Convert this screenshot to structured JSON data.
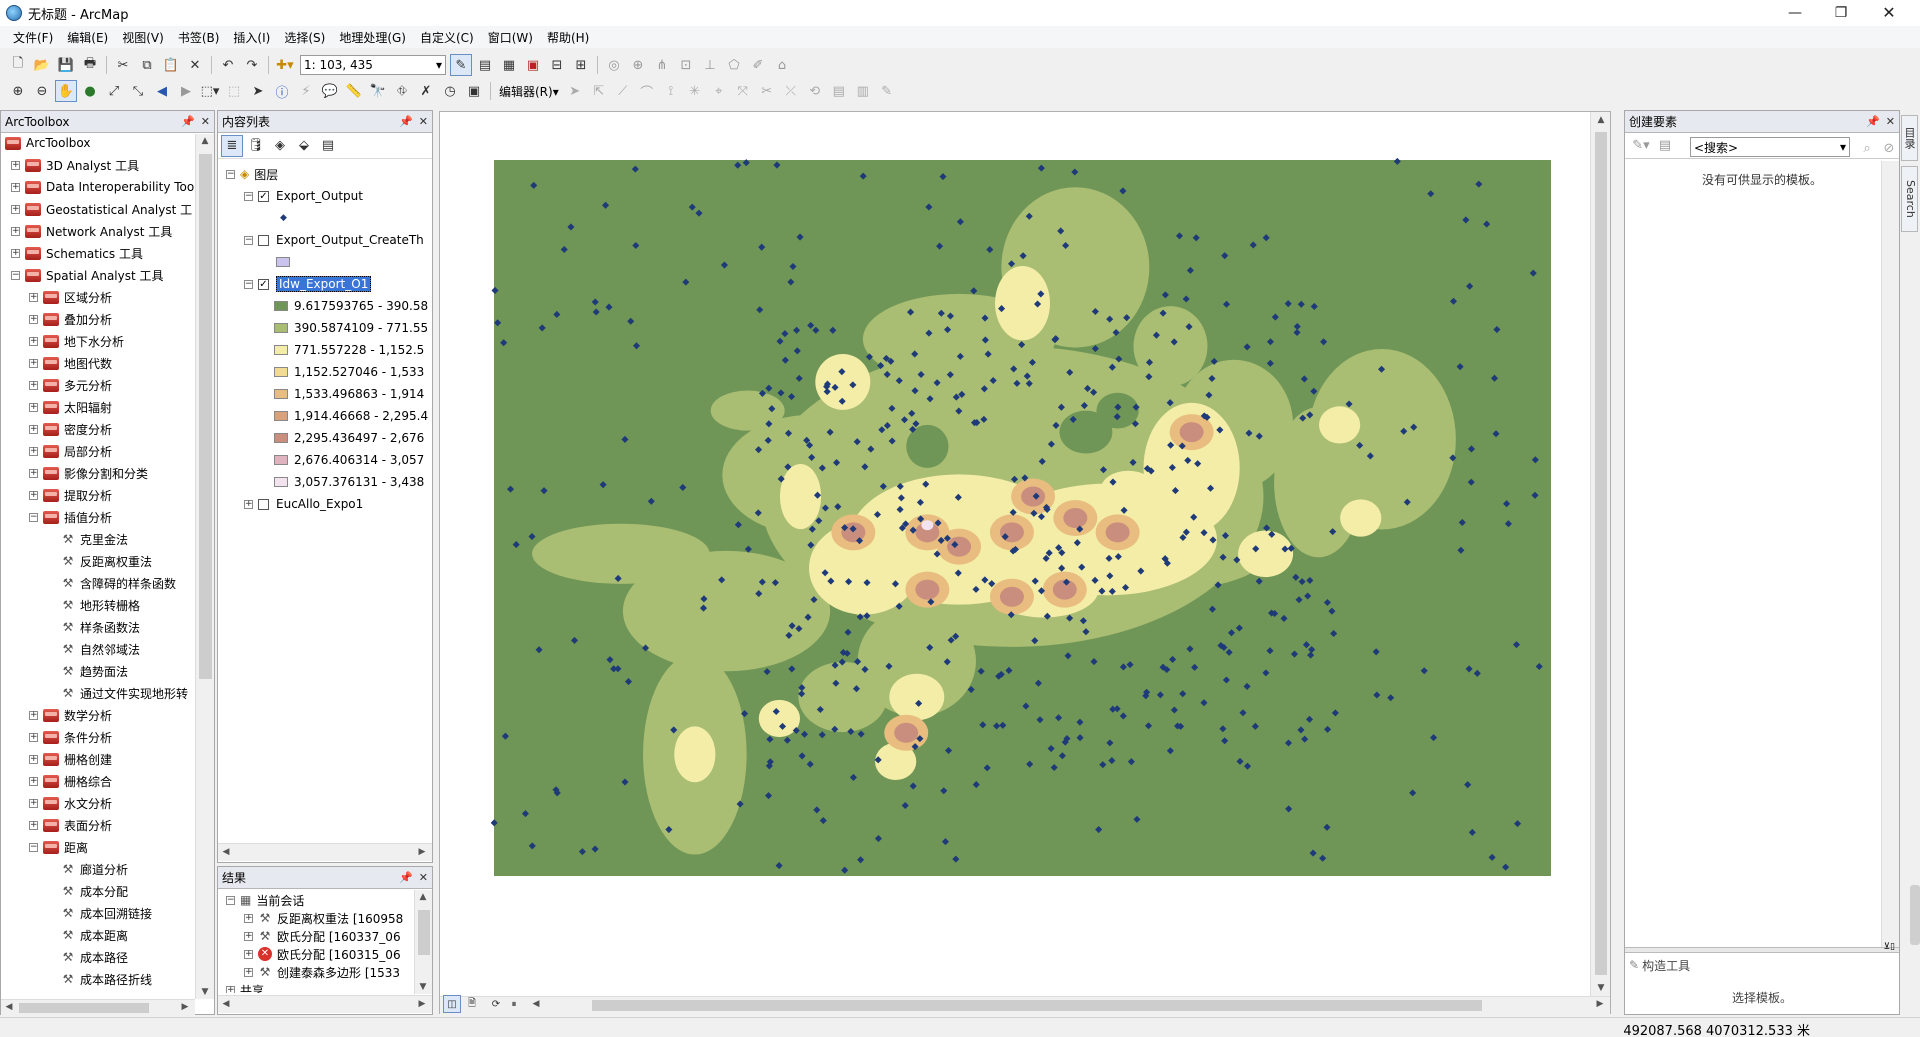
{
  "window": {
    "title": "无标题 - ArcMap"
  },
  "menu": [
    "文件(F)",
    "编辑(E)",
    "视图(V)",
    "书签(B)",
    "插入(I)",
    "选择(S)",
    "地理处理(G)",
    "自定义(C)",
    "窗口(W)",
    "帮助(H)"
  ],
  "toolbar": {
    "scale": "1: 103, 435",
    "editor_label": "编辑器(R)▾"
  },
  "arctoolbox": {
    "title": "ArcToolbox",
    "root": "ArcToolbox",
    "items": [
      "3D Analyst 工具",
      "Data Interoperability Too",
      "Geostatistical Analyst 工",
      "Network Analyst 工具",
      "Schematics 工具",
      "Spatial Analyst 工具",
      "区域分析",
      "叠加分析",
      "地下水分析",
      "地图代数",
      "多元分析",
      "太阳辐射",
      "密度分析",
      "局部分析",
      "影像分割和分类",
      "提取分析",
      "插值分析",
      "克里金法",
      "反距离权重法",
      "含障碍的样条函数",
      "地形转栅格",
      "样条函数法",
      "自然邻域法",
      "趋势面法",
      "通过文件实现地形转",
      "数学分析",
      "条件分析",
      "栅格创建",
      "栅格综合",
      "水文分析",
      "表面分析",
      "距离",
      "廊道分析",
      "成本分配",
      "成本回溯链接",
      "成本距离",
      "成本路径",
      "成本路径折线"
    ]
  },
  "toc": {
    "title": "内容列表",
    "root": "图层",
    "layers": [
      "Export_Output",
      "Export_Output_CreateTh",
      "Idw_Export_O1",
      "EucAllo_Expo1"
    ],
    "legend": [
      {
        "label": "9.617593765 - 390.58",
        "color": "#6f9656"
      },
      {
        "label": "390.5874109 - 771.55",
        "color": "#a9bd73"
      },
      {
        "label": "771.557228 - 1,152.5",
        "color": "#f3eda8"
      },
      {
        "label": "1,152.527046 - 1,533",
        "color": "#f2dc91"
      },
      {
        "label": "1,533.496863 - 1,914",
        "color": "#e8bd7f"
      },
      {
        "label": "1,914.46668 - 2,295.4",
        "color": "#d8a27c"
      },
      {
        "label": "2,295.436497 - 2,676",
        "color": "#c98e7e"
      },
      {
        "label": "2,676.406314 - 3,057",
        "color": "#e0b4bf"
      },
      {
        "label": "3,057.376131 - 3,438",
        "color": "#f3e3ee"
      }
    ]
  },
  "results": {
    "title": "结果",
    "session": "当前会话",
    "items": [
      "反距离权重法 [160958",
      "欧氏分配 [160337_06",
      "欧氏分配 [160315_06",
      "创建泰森多边形 [1533"
    ],
    "partial": "共享"
  },
  "create_features": {
    "title": "创建要素",
    "search_placeholder": "<搜索>",
    "empty_msg": "没有可供显示的模板。",
    "construct_title": "构造工具",
    "construct_msg": "选择模板。"
  },
  "side_tabs": [
    "目录",
    "Search"
  ],
  "status": {
    "coords": "492087.568  4070312.533 米"
  },
  "colors": {
    "bg": "#6f9656",
    "c2": "#a9bd73",
    "c3": "#f3eda8",
    "c4": "#e8bd7f",
    "c5": "#c98e7e",
    "point": "#1f3a78",
    "selection": "#3875d7"
  }
}
